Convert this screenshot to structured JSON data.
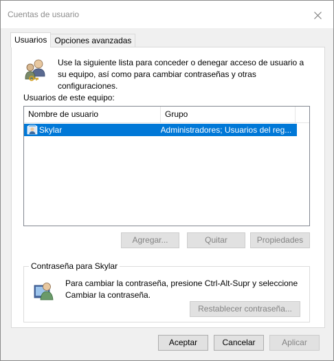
{
  "window": {
    "title": "Cuentas de usuario"
  },
  "tabs": [
    {
      "label": "Usuarios",
      "active": true
    },
    {
      "label": "Opciones avanzadas",
      "active": false
    }
  ],
  "info": {
    "text": "Use la siguiente lista para conceder o denegar acceso de usuario a su equipo, así como para cambiar contraseñas y otras configuraciones."
  },
  "users": {
    "label": "Usuarios de este equipo:",
    "columns": [
      "Nombre de usuario",
      "Grupo"
    ],
    "rows": [
      {
        "name": "Skylar",
        "group": "Administradores; Usuarios del reg...",
        "selected": true
      }
    ]
  },
  "list_buttons": {
    "add": "Agregar...",
    "remove": "Quitar",
    "properties": "Propiedades"
  },
  "password": {
    "legend": "Contraseña para Skylar",
    "text": "Para cambiar la contraseña, presione Ctrl-Alt-Supr y seleccione Cambiar la contraseña.",
    "reset_button": "Restablecer contraseña..."
  },
  "footer": {
    "ok": "Aceptar",
    "cancel": "Cancelar",
    "apply": "Aplicar"
  },
  "colors": {
    "selection": "#0078d7",
    "window_bg": "#f0f0f0",
    "disabled_text": "#838383"
  },
  "icons": {
    "close": "close-icon",
    "info": "users-keys-icon",
    "user_row": "user-icon",
    "password": "user-password-icon"
  }
}
